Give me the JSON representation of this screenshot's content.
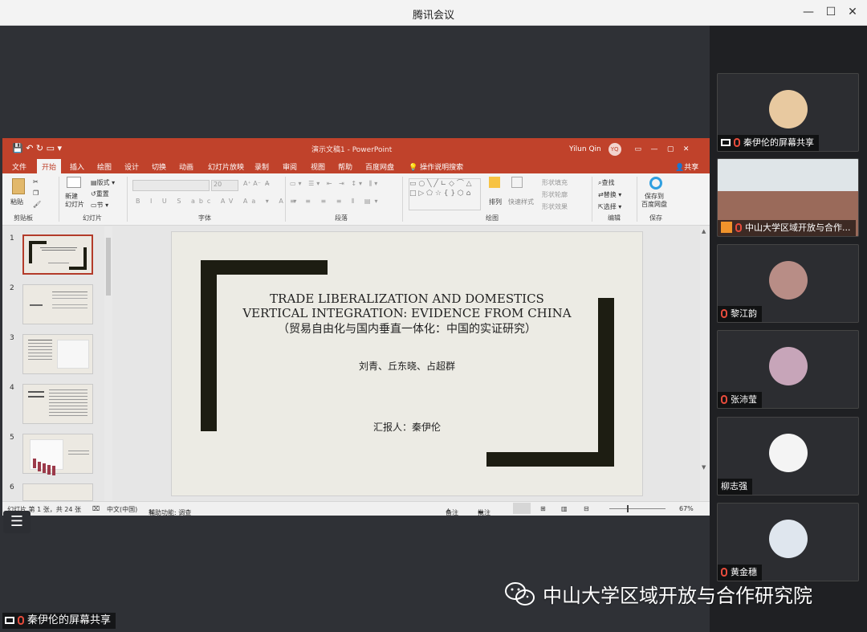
{
  "window": {
    "title": "腾讯会议",
    "minimize": "—",
    "maximize": "☐",
    "close": "✕"
  },
  "powerpoint": {
    "title": "演示文稿1 - PowerPoint",
    "user": "Yilun Qin",
    "user_initials": "YQ",
    "share": "共享",
    "tabs": [
      "文件",
      "开始",
      "插入",
      "绘图",
      "设计",
      "切换",
      "动画",
      "幻灯片放映",
      "录制",
      "审阅",
      "视图",
      "帮助",
      "百度网盘",
      "操作说明搜索"
    ],
    "ribbon": {
      "paste": "粘贴",
      "clipboard": "剪贴板",
      "new_slide": "新建\n幻灯片",
      "layout": "版式",
      "reset": "重置",
      "section": "节",
      "slides": "幻灯片",
      "font_size": "20",
      "font": "字体",
      "paragraph": "段落",
      "arrange": "排列",
      "quick_styles": "快速样式",
      "shape_fill": "形状填充",
      "shape_outline": "形状轮廓",
      "shape_effects": "形状效果",
      "drawing": "绘图",
      "find": "查找",
      "replace": "替换",
      "select": "选择",
      "editing": "编辑",
      "save_to": "保存到\n百度网盘",
      "save": "保存"
    },
    "slides": [
      "1",
      "2",
      "3",
      "4",
      "5",
      "6"
    ],
    "slide": {
      "title_line1": "TRADE LIBERALIZATION AND DOMESTICS",
      "title_line2": "VERTICAL INTEGRATION: EVIDENCE FROM CHINA",
      "title_line3": "（贸易自由化与国内垂直一体化：中国的实证研究）",
      "authors": "刘青、丘东晓、占超群",
      "presenter": "汇报人：秦伊伦"
    },
    "status": {
      "slide_info": "幻灯片 第 1 张，共 24 张",
      "language": "中文(中国)",
      "accessibility": "辅助功能: 调查",
      "notes": "备注",
      "comments": "批注",
      "zoom": "67%"
    }
  },
  "participants": [
    {
      "name": "秦伊伦的屏幕共享",
      "color": "#e8c9a0"
    },
    {
      "name": "中山大学区域开放与合作...",
      "color": "#7a8a9a"
    },
    {
      "name": "黎江韵",
      "color": "#b88d86"
    },
    {
      "name": "张沛莹",
      "color": "#c7a5b9"
    },
    {
      "name": "柳志强",
      "color": "#f4f4f4"
    },
    {
      "name": "黄金穗",
      "color": "#dfe6ee"
    }
  ],
  "watermark": "中山大学区域开放与合作研究院",
  "bottom_label": "秦伊伦的屏幕共享",
  "list_icon": "☰"
}
